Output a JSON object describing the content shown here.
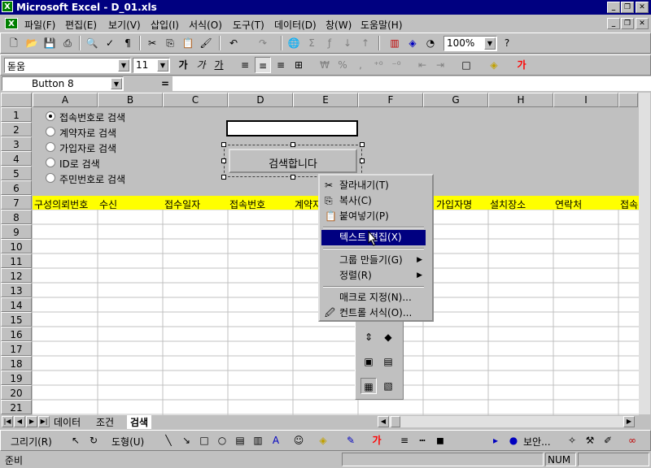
{
  "title": "Microsoft Excel - D_01.xls",
  "menu": [
    "파일(F)",
    "편집(E)",
    "보기(V)",
    "삽입(I)",
    "서식(O)",
    "도구(T)",
    "데이터(D)",
    "창(W)",
    "도움말(H)"
  ],
  "toolbar": {
    "zoom": "100%",
    "font": "돋움",
    "size": "11"
  },
  "formula": {
    "name_box": "Button 8",
    "equals": "="
  },
  "columns": [
    "A",
    "B",
    "C",
    "D",
    "E",
    "F",
    "G",
    "H",
    "I"
  ],
  "rows": [
    "1",
    "2",
    "3",
    "4",
    "5",
    "6",
    "7",
    "8",
    "9",
    "10",
    "11",
    "12",
    "13",
    "14",
    "15",
    "16",
    "17",
    "18",
    "19",
    "20",
    "21"
  ],
  "radios": [
    "접속번호로 검색",
    "계약자로 검색",
    "가입자로 검색",
    "ID로 검색",
    "주민번호로 검색"
  ],
  "search_button": "검색합니다",
  "header_row": [
    "구성의뢰번호",
    "수신",
    "접수일자",
    "접속번호",
    "계약자",
    "",
    "가입자명",
    "설치장소",
    "연락처",
    "접속"
  ],
  "context_menu": {
    "cut": "잘라내기(T)",
    "copy": "복사(C)",
    "paste": "붙여넣기(P)",
    "edit_text": "텍스트 편집(X)",
    "group": "그룹 만들기(G)",
    "order": "정렬(R)",
    "assign_macro": "매크로 지정(N)...",
    "format_control": "컨트롤 서식(O)..."
  },
  "sheet_tabs": [
    "데이터",
    "조건",
    "검색"
  ],
  "drawing": {
    "draw": "그리기(R)",
    "autoshape": "도형(U)",
    "security": "보안..."
  },
  "status": {
    "ready": "준비",
    "num": "NUM"
  },
  "colors": {
    "title_bar": "#000080",
    "header_fill": "#ffff00",
    "selection": "#000080"
  }
}
